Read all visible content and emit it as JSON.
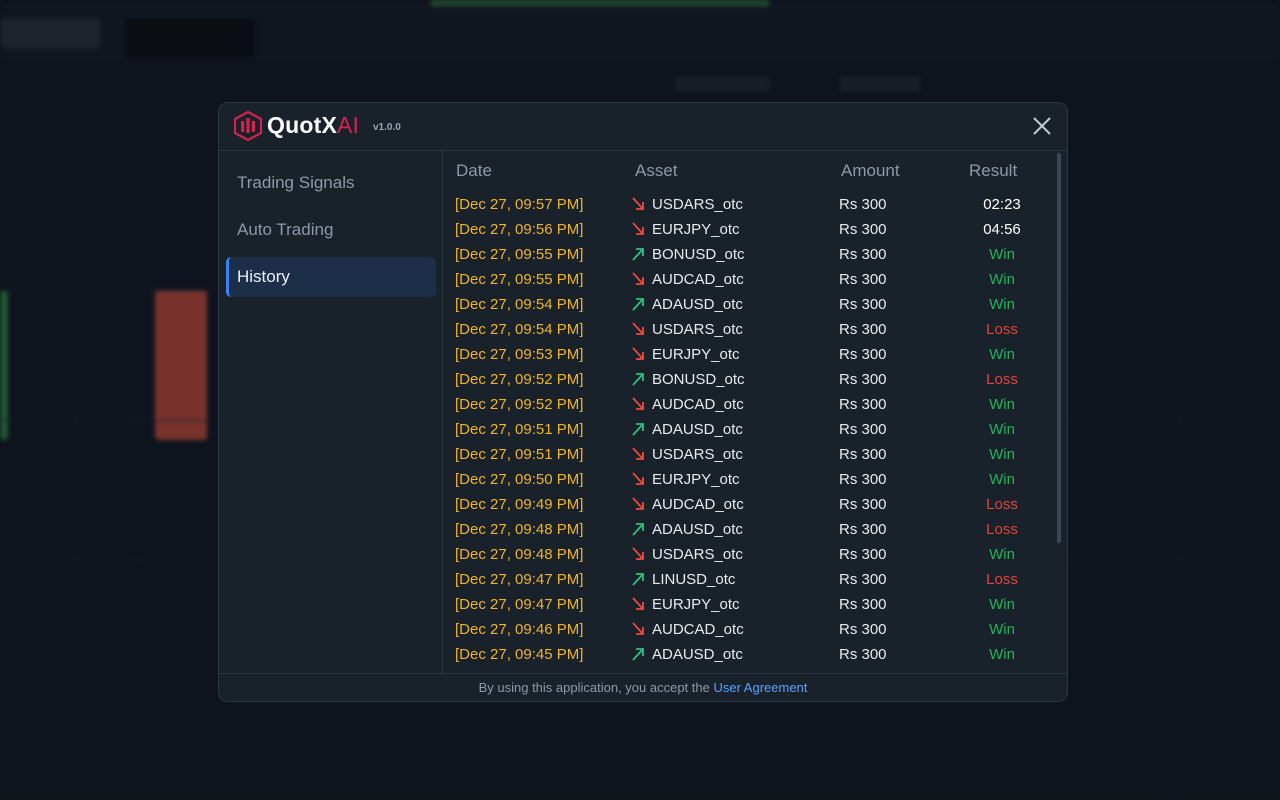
{
  "app": {
    "brand_main": "QuotX",
    "brand_ai": "AI",
    "version": "v1.0.0"
  },
  "nav": [
    {
      "label": "Trading Signals",
      "active": false
    },
    {
      "label": "Auto Trading",
      "active": false
    },
    {
      "label": "History",
      "active": true
    }
  ],
  "table": {
    "headers": {
      "date": "Date",
      "asset": "Asset",
      "amount": "Amount",
      "result": "Result"
    },
    "rows": [
      {
        "date": "[Dec 27, 09:57 PM]",
        "dir": "down",
        "asset": "USDARS_otc",
        "amount": "Rs 300",
        "result": "02:23",
        "status": "pending"
      },
      {
        "date": "[Dec 27, 09:56 PM]",
        "dir": "down",
        "asset": "EURJPY_otc",
        "amount": "Rs 300",
        "result": "04:56",
        "status": "pending"
      },
      {
        "date": "[Dec 27, 09:55 PM]",
        "dir": "up",
        "asset": "BONUSD_otc",
        "amount": "Rs 300",
        "result": "Win",
        "status": "win"
      },
      {
        "date": "[Dec 27, 09:55 PM]",
        "dir": "down",
        "asset": "AUDCAD_otc",
        "amount": "Rs 300",
        "result": "Win",
        "status": "win"
      },
      {
        "date": "[Dec 27, 09:54 PM]",
        "dir": "up",
        "asset": "ADAUSD_otc",
        "amount": "Rs 300",
        "result": "Win",
        "status": "win"
      },
      {
        "date": "[Dec 27, 09:54 PM]",
        "dir": "down",
        "asset": "USDARS_otc",
        "amount": "Rs 300",
        "result": "Loss",
        "status": "loss"
      },
      {
        "date": "[Dec 27, 09:53 PM]",
        "dir": "down",
        "asset": "EURJPY_otc",
        "amount": "Rs 300",
        "result": "Win",
        "status": "win"
      },
      {
        "date": "[Dec 27, 09:52 PM]",
        "dir": "up",
        "asset": "BONUSD_otc",
        "amount": "Rs 300",
        "result": "Loss",
        "status": "loss"
      },
      {
        "date": "[Dec 27, 09:52 PM]",
        "dir": "down",
        "asset": "AUDCAD_otc",
        "amount": "Rs 300",
        "result": "Win",
        "status": "win"
      },
      {
        "date": "[Dec 27, 09:51 PM]",
        "dir": "up",
        "asset": "ADAUSD_otc",
        "amount": "Rs 300",
        "result": "Win",
        "status": "win"
      },
      {
        "date": "[Dec 27, 09:51 PM]",
        "dir": "down",
        "asset": "USDARS_otc",
        "amount": "Rs 300",
        "result": "Win",
        "status": "win"
      },
      {
        "date": "[Dec 27, 09:50 PM]",
        "dir": "down",
        "asset": "EURJPY_otc",
        "amount": "Rs 300",
        "result": "Win",
        "status": "win"
      },
      {
        "date": "[Dec 27, 09:49 PM]",
        "dir": "down",
        "asset": "AUDCAD_otc",
        "amount": "Rs 300",
        "result": "Loss",
        "status": "loss"
      },
      {
        "date": "[Dec 27, 09:48 PM]",
        "dir": "up",
        "asset": "ADAUSD_otc",
        "amount": "Rs 300",
        "result": "Loss",
        "status": "loss"
      },
      {
        "date": "[Dec 27, 09:48 PM]",
        "dir": "down",
        "asset": "USDARS_otc",
        "amount": "Rs 300",
        "result": "Win",
        "status": "win"
      },
      {
        "date": "[Dec 27, 09:47 PM]",
        "dir": "up",
        "asset": "LINUSD_otc",
        "amount": "Rs 300",
        "result": "Loss",
        "status": "loss"
      },
      {
        "date": "[Dec 27, 09:47 PM]",
        "dir": "down",
        "asset": "EURJPY_otc",
        "amount": "Rs 300",
        "result": "Win",
        "status": "win"
      },
      {
        "date": "[Dec 27, 09:46 PM]",
        "dir": "down",
        "asset": "AUDCAD_otc",
        "amount": "Rs 300",
        "result": "Win",
        "status": "win"
      },
      {
        "date": "[Dec 27, 09:45 PM]",
        "dir": "up",
        "asset": "ADAUSD_otc",
        "amount": "Rs 300",
        "result": "Win",
        "status": "win"
      }
    ]
  },
  "footer": {
    "text": "By using this application, you accept the ",
    "link": "User Agreement"
  },
  "colors": {
    "date": "#f0b429",
    "win": "#22b35a",
    "loss": "#e0453a",
    "pending": "#ffffff",
    "arrow_up": "#2ec27e",
    "arrow_down": "#ef4a3b",
    "brand_accent": "#d3234e",
    "link": "#5aa2ff"
  }
}
